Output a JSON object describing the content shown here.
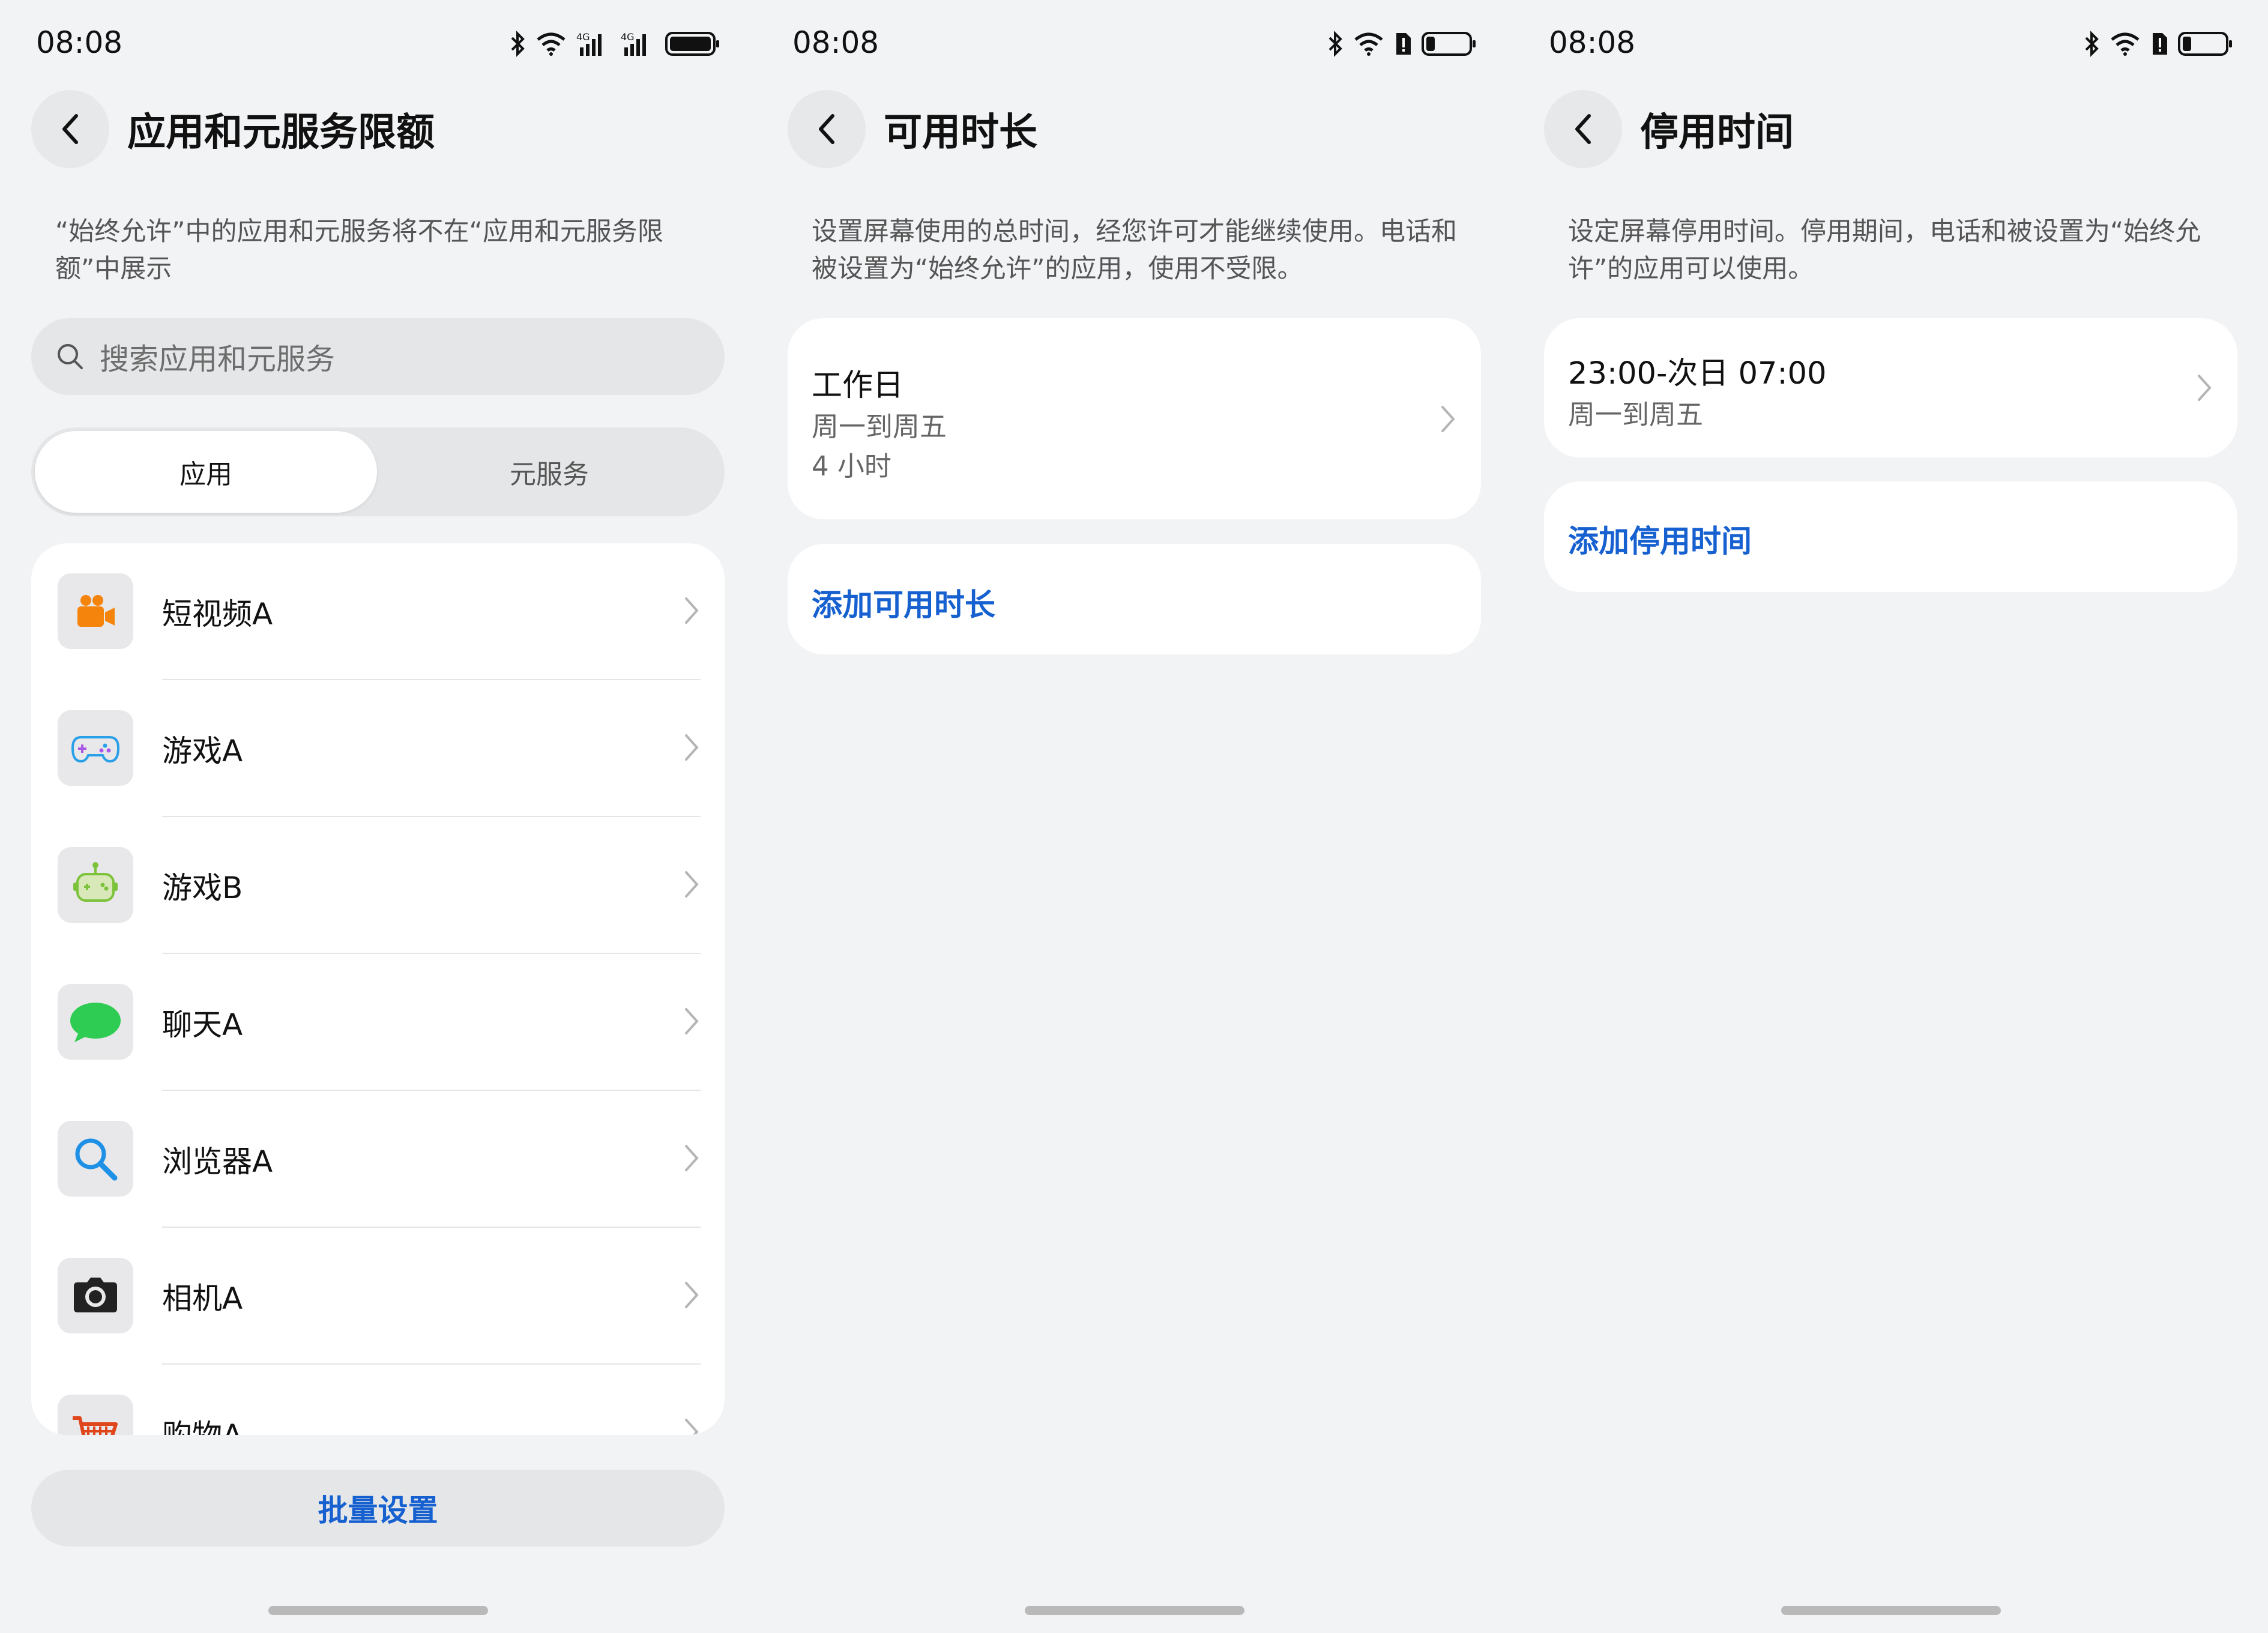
{
  "status": {
    "time": "08:08"
  },
  "panel1": {
    "title": "应用和元服务限额",
    "description": "“始终允许”中的应用和元服务将不在“应用和元服务限额”中展示",
    "search_placeholder": "搜索应用和元服务",
    "tabs": [
      {
        "label": "应用",
        "selected": true
      },
      {
        "label": "元服务",
        "selected": false
      }
    ],
    "apps": [
      {
        "label": "短视频A",
        "icon": "video-camera-icon"
      },
      {
        "label": "游戏A",
        "icon": "gamepad-icon"
      },
      {
        "label": "游戏B",
        "icon": "robot-game-icon"
      },
      {
        "label": "聊天A",
        "icon": "chat-bubble-icon"
      },
      {
        "label": "浏览器A",
        "icon": "magnifier-icon"
      },
      {
        "label": "相机A",
        "icon": "camera-icon"
      },
      {
        "label": "购物A",
        "icon": "shopping-cart-icon"
      }
    ],
    "bulk_button": "批量设置"
  },
  "panel2": {
    "title": "可用时长",
    "description": "设置屏幕使用的总时间，经您许可才能继续使用。电话和被设置为“始终允许”的应用，使用不受限。",
    "entry": {
      "title": "工作日",
      "days": "周一到周五",
      "duration": "4 小时"
    },
    "add_button": "添加可用时长"
  },
  "panel3": {
    "title": "停用时间",
    "description": "设定屏幕停用时间。停用期间，电话和被设置为“始终允许”的应用可以使用。",
    "entry": {
      "time_range": "23:00-次日 07:00",
      "days": "周一到周五"
    },
    "add_button": "添加停用时间"
  },
  "colors": {
    "accent": "#1660d0",
    "background": "#f1f3f5",
    "card": "#ffffff"
  }
}
